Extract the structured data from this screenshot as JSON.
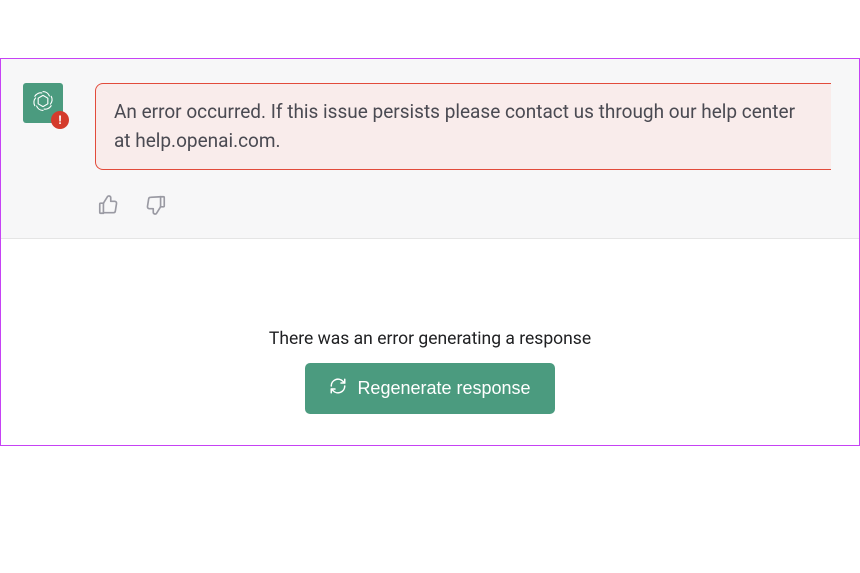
{
  "message": {
    "error_text": "An error occurred. If this issue persists please contact us through our help center at help.openai.com."
  },
  "footer": {
    "notice": "There was an error generating a response",
    "regenerate_label": "Regenerate response"
  },
  "icons": {
    "avatar": "openai-logo-icon",
    "avatar_badge": "error-badge-icon",
    "thumbs_up": "thumbs-up-icon",
    "thumbs_down": "thumbs-down-icon",
    "refresh": "refresh-icon"
  }
}
